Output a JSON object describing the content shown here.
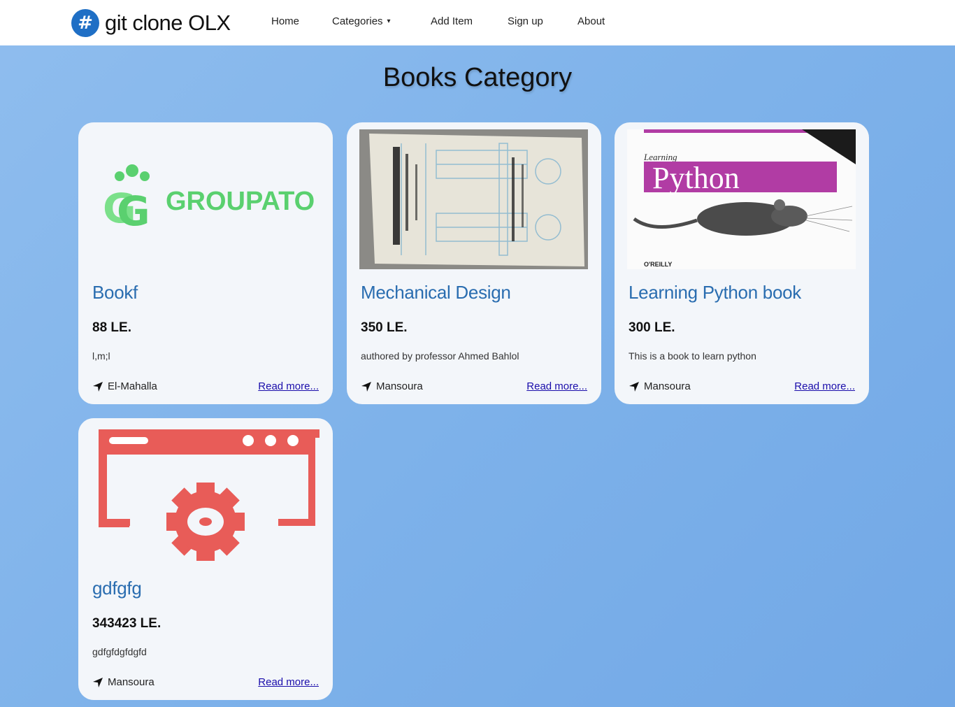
{
  "brand": {
    "badge": "#",
    "name": "git clone OLX"
  },
  "nav": {
    "home": "Home",
    "categories": "Categories",
    "categories_caret": "▾",
    "add_item": "Add Item",
    "sign_up": "Sign up",
    "about": "About"
  },
  "page": {
    "title": "Books Category"
  },
  "cards": [
    {
      "image": {
        "logo_text": "GROUPATOR"
      },
      "title": "Bookf",
      "price": "88 LE.",
      "description": "l,m;l",
      "location": "El-Mahalla",
      "read_more": "Read more..."
    },
    {
      "image": {},
      "title": "Mechanical Design",
      "price": "350 LE.",
      "description": "authored by professor Ahmed Bahlol",
      "location": "Mansoura",
      "read_more": "Read more..."
    },
    {
      "image": {
        "cover_small": "Learning",
        "cover_title": "Python",
        "publisher": "O'REILLY"
      },
      "title": "Learning Python book",
      "price": "300 LE.",
      "description": "This is a book to learn python",
      "location": "Mansoura",
      "read_more": "Read more..."
    },
    {
      "image": {},
      "title": "gdfgfg",
      "price": "343423 LE.",
      "description": "gdfgfdgfdgfd",
      "location": "Mansoura",
      "read_more": "Read more..."
    }
  ],
  "colors": {
    "accent": "#2a6db0",
    "brand_badge": "#1f6fc5",
    "card_bg": "#f3f6fa",
    "link": "#1a0dab",
    "placeholder_red": "#e85c58",
    "groupator_green": "#5ad06f"
  }
}
